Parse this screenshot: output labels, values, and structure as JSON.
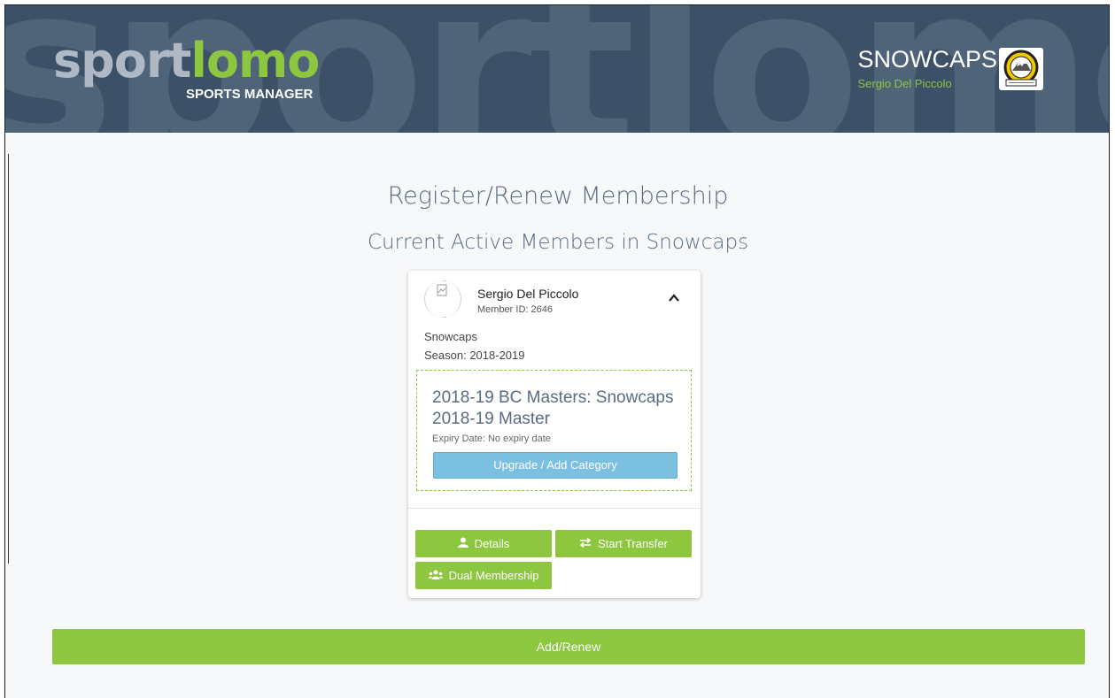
{
  "header": {
    "bg_word": "sportlomo",
    "logo_sport": "sport",
    "logo_lomo": "lomo",
    "logo_sub": "SPORTS MANAGER",
    "club_name": "SNOWCAPS",
    "user_name": "Sergio Del Piccolo"
  },
  "page": {
    "title": "Register/Renew Membership",
    "subtitle": "Current Active Members in Snowcaps"
  },
  "member": {
    "name": "Sergio Del Piccolo",
    "member_id": "Member ID: 2646",
    "club": "Snowcaps",
    "season": "Season: 2018-2019",
    "membership_line1": "2018-19 BC Masters: Snowcaps",
    "membership_line2": "2018-19 Master",
    "expiry": "Expiry Date: No expiry date",
    "upgrade_label": "Upgrade / Add Category",
    "details_label": "Details",
    "transfer_label": "Start Transfer",
    "dual_label": "Dual Membership"
  },
  "actions": {
    "add_renew_label": "Add/Renew"
  },
  "colors": {
    "header_bg": "#3c5068",
    "accent_green": "#8dc63f",
    "upgrade_blue": "#7bbfe1",
    "title_slate": "#5a6c82"
  }
}
